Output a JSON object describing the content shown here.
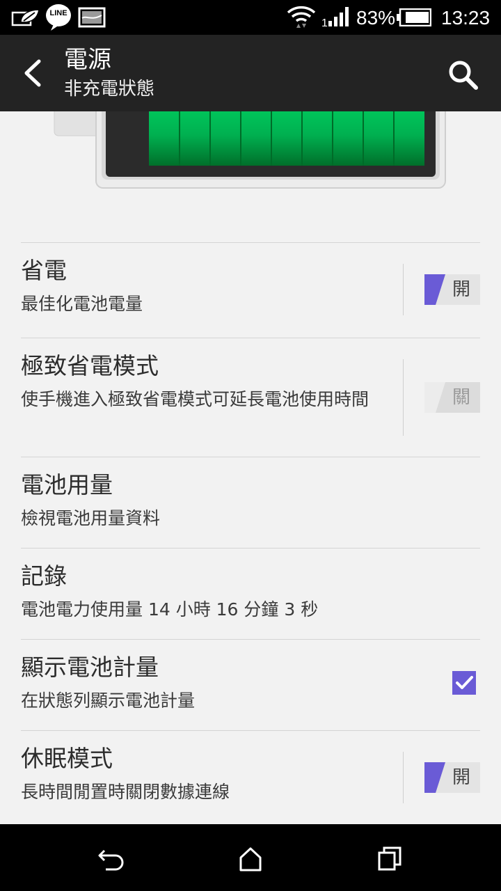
{
  "status_bar": {
    "battery_percent": "83%",
    "time": "13:23",
    "icons": [
      "leaf-notification-icon",
      "line-app-icon",
      "image-notification-icon",
      "wifi-icon",
      "signal-icon",
      "battery-icon"
    ],
    "line_text": "LINE"
  },
  "action_bar": {
    "title": "電源",
    "subtitle": "非充電狀態"
  },
  "settings": [
    {
      "title": "省電",
      "subtitle": "最佳化電池電量",
      "control": "toggle",
      "toggle_label": "開",
      "enabled": true
    },
    {
      "title": "極致省電模式",
      "subtitle": "使手機進入極致省電模式可延長電池使用時間",
      "control": "toggle",
      "toggle_label": "關",
      "enabled": false
    },
    {
      "title": "電池用量",
      "subtitle": "檢視電池用量資料",
      "control": "none"
    },
    {
      "title": "記錄",
      "subtitle": "電池電力使用量 14 小時 16 分鐘 3 秒",
      "control": "none"
    },
    {
      "title": "顯示電池計量",
      "subtitle": "在狀態列顯示電池計量",
      "control": "checkbox",
      "checked": true
    },
    {
      "title": "休眠模式",
      "subtitle": "長時間閒置時關閉數據連線",
      "control": "toggle",
      "toggle_label": "開",
      "enabled": true
    }
  ],
  "colors": {
    "accent": "#6a5bd6",
    "battery_green": "#00c853",
    "action_bar": "#232323"
  }
}
